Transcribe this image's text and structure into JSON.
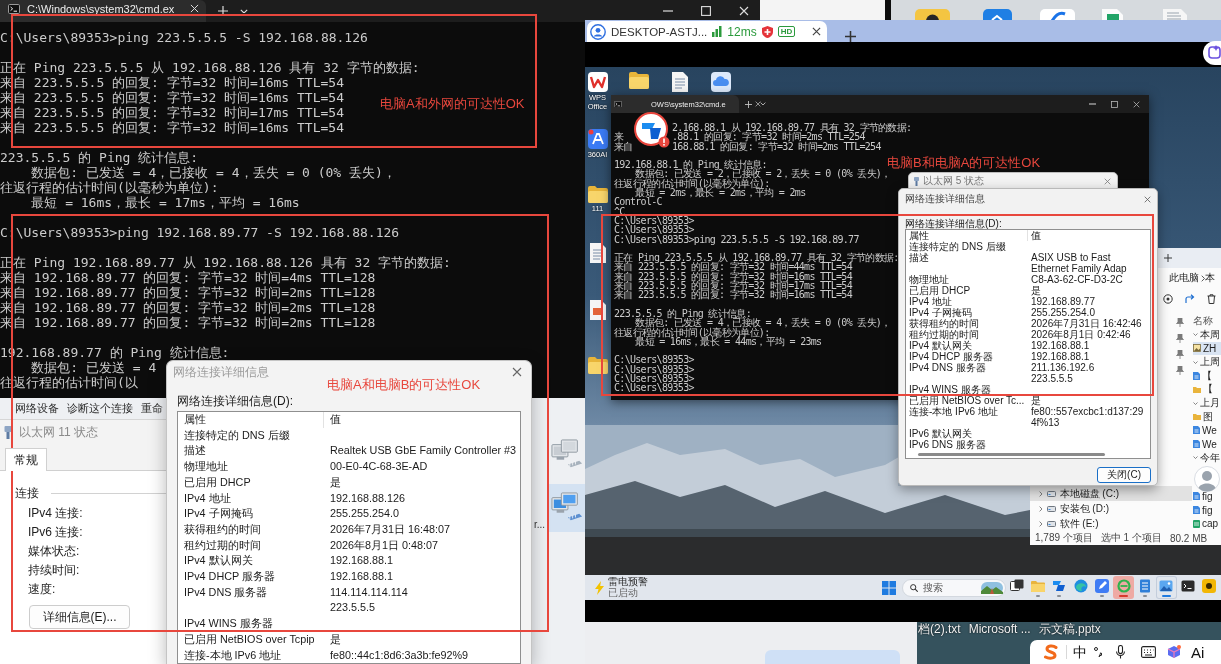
{
  "cmd_window": {
    "tab_title": "C:\\Windows\\system32\\cmd.ex",
    "output_blocks": [
      [
        "C:\\Users\\89353>ping 223.5.5.5 -S 192.168.88.126"
      ],
      [
        "正在 Ping 223.5.5.5 从 192.168.88.126 具有 32 字节的数据:",
        "来自 223.5.5.5 的回复: 字节=32 时间=16ms TTL=54",
        "来自 223.5.5.5 的回复: 字节=32 时间=16ms TTL=54",
        "来自 223.5.5.5 的回复: 字节=32 时间=17ms TTL=54",
        "来自 223.5.5.5 的回复: 字节=32 时间=16ms TTL=54"
      ],
      [
        "223.5.5.5 的 Ping 统计信息:",
        "    数据包: 已发送 = 4，已接收 = 4，丢失 = 0 (0% 丢失)，",
        "往返行程的估计时间(以毫秒为单位):",
        "    最短 = 16ms，最长 = 17ms，平均 = 16ms"
      ],
      [
        "C:\\Users\\89353>ping 192.168.89.77 -S 192.168.88.126"
      ],
      [
        "正在 Ping 192.168.89.77 从 192.168.88.126 具有 32 字节的数据:",
        "来自 192.168.89.77 的回复: 字节=32 时间=4ms TTL=128",
        "来自 192.168.89.77 的回复: 字节=32 时间=2ms TTL=128",
        "来自 192.168.89.77 的回复: 字节=32 时间=2ms TTL=128",
        "来自 192.168.89.77 的回复: 字节=32 时间=2ms TTL=128"
      ],
      [
        "192.168.89.77 的 Ping 统计信息:",
        "    数据包: 已发送 = 4",
        "往返行程的估计时间(以"
      ]
    ]
  },
  "connections_window": {
    "toolbar": [
      "网络设备",
      "诊断这个连接",
      "重命"
    ],
    "label_fragment": "r...",
    "adapters": [
      {
        "connected": false,
        "selected": false
      },
      {
        "connected": true,
        "selected": true
      }
    ]
  },
  "status_dialog": {
    "title": "以太网 11 状态",
    "tabs": [
      {
        "label": "常规",
        "selected": true
      }
    ],
    "section": "连接",
    "fields": [
      "IPv4 连接:",
      "IPv6 连接:",
      "媒体状态:",
      "持续时间:",
      "速度:"
    ],
    "details_button": "详细信息(E)..."
  },
  "details_dialog": {
    "title": "网络连接详细信息",
    "list_label": "网络连接详细信息(D):",
    "columns": [
      "属性",
      "值"
    ],
    "rows": [
      {
        "property": "连接特定的 DNS 后缀"
      },
      {
        "property": "描述",
        "value": "Realtek USB GbE Family Controller #3"
      },
      {
        "property": "物理地址",
        "value": "00-E0-4C-68-3E-AD"
      },
      {
        "property": "已启用 DHCP",
        "value": "是"
      },
      {
        "property": "IPv4 地址",
        "value": "192.168.88.126"
      },
      {
        "property": "IPv4 子网掩码",
        "value": "255.255.254.0"
      },
      {
        "property": "获得租约的时间",
        "value": "2026年7月31日 16:48:07"
      },
      {
        "property": "租约过期的时间",
        "value": "2026年8月1日 0:48:07"
      },
      {
        "property": "IPv4 默认网关",
        "value": "192.168.88.1"
      },
      {
        "property": "IPv4 DHCP 服务器",
        "value": "192.168.88.1"
      },
      {
        "property": "IPv4 DNS 服务器",
        "value": "114.114.114.114"
      },
      {
        "value": "223.5.5.5"
      },
      {
        "property": "IPv4 WINS 服务器"
      },
      {
        "property": "已启用 NetBIOS over Tcpip",
        "value": "是"
      },
      {
        "property": "连接-本地 IPv6 地址",
        "value": "fe80::44c1:8d6:3a3b:fe92%9"
      }
    ]
  },
  "remote_window": {
    "tab": {
      "title": "DESKTOP-ASTJ...",
      "latency": "12ms",
      "quality_badge": "HD"
    },
    "desktop_icon_columns": [
      [
        {
          "kind": "wps",
          "label": "WPS Office"
        },
        {
          "kind": "ai",
          "label": "360AI"
        },
        {
          "kind": "folder",
          "label": "111"
        },
        {
          "kind": "text-file"
        },
        {
          "kind": "presentation"
        },
        {
          "kind": "folder"
        }
      ],
      [
        {
          "kind": "folder"
        }
      ],
      [
        {
          "kind": "text-file"
        }
      ],
      [
        {
          "kind": "cloud"
        }
      ]
    ],
    "cmd_window": {
      "tab_title": "OWS\\system32\\cmd.e",
      "covered_lines": [
        {
          "right": "2.168.88.1 从 192.168.89.77 具有 32 字节的数据:"
        },
        {
          "left": "来",
          "right": ".88.1 的回复: 字节=32 时间=2ms TTL=254"
        },
        {
          "left": "来自",
          "right": "168.88.1 的回复: 字节=32 时间=2ms TTL=254"
        }
      ],
      "output_blocks": [
        [
          "192.168.88.1 的 Ping 统计信息:",
          "    数据包: 已发送 = 2，已接收 = 2，丢失 = 0 (0% 丢失)，",
          "往返行程的估计时间(以毫秒为单位):",
          "    最短 = 2ms，最长 = 2ms，平均 = 2ms",
          "Control-C",
          "^C",
          "C:\\Users\\89353>",
          "C:\\Users\\89353>",
          "C:\\Users\\89353>ping 223.5.5.5 -S 192.168.89.77"
        ],
        [
          "正在 Ping 223.5.5.5 从 192.168.89.77 具有 32 字节的数据:",
          "来自 223.5.5.5 的回复: 字节=32 时间=44ms TTL=54",
          "来自 223.5.5.5 的回复: 字节=32 时间=16ms TTL=54",
          "来自 223.5.5.5 的回复: 字节=32 时间=17ms TTL=54",
          "来自 223.5.5.5 的回复: 字节=32 时间=16ms TTL=54"
        ],
        [
          "223.5.5.5 的 Ping 统计信息:",
          "    数据包: 已发送 = 4，已接收 = 4，丢失 = 0 (0% 丢失)，",
          "往返行程的估计时间(以毫秒为单位):",
          "    最短 = 16ms，最长 = 44ms，平均 = 23ms"
        ],
        [
          "C:\\Users\\89353>",
          "C:\\Users\\89353>",
          "C:\\Users\\89353>",
          "C:\\Users\\89353>"
        ]
      ]
    },
    "status_window_title": "以太网 5 状态",
    "details_dialog": {
      "title": "网络连接详细信息",
      "list_label": "网络连接详细信息(D):",
      "columns": [
        "属性",
        "值"
      ],
      "rows": [
        {
          "property": "连接特定的 DNS 后缀"
        },
        {
          "property": "描述",
          "value": "ASIX USB to Fast Ethernet Family Adap"
        },
        {
          "property": "物理地址",
          "value": "C8-A3-62-CF-D3-2C"
        },
        {
          "property": "已启用 DHCP",
          "value": "是"
        },
        {
          "property": "IPv4 地址",
          "value": "192.168.89.77"
        },
        {
          "property": "IPv4 子网掩码",
          "value": "255.255.254.0"
        },
        {
          "property": "获得租约的时间",
          "value": "2026年7月31日 16:42:46"
        },
        {
          "property": "租约过期的时间",
          "value": "2026年8月1日 0:42:46"
        },
        {
          "property": "IPv4 默认网关",
          "value": "192.168.88.1"
        },
        {
          "property": "IPv4 DHCP 服务器",
          "value": "192.168.88.1"
        },
        {
          "property": "IPv4 DNS 服务器",
          "value": "211.136.192.6"
        },
        {
          "value": "223.5.5.5"
        },
        {
          "property": "IPv4 WINS 服务器"
        },
        {
          "property": "已启用 NetBIOS over Tc...",
          "value": "是"
        },
        {
          "property": "连接-本地 IPv6 地址",
          "value": "fe80::557excbc1:d137:294f%13"
        },
        {
          "property": "IPv6 默认网关"
        },
        {
          "property": "IPv6 DNS 服务器"
        }
      ],
      "close_button": "关闭(C)"
    },
    "explorer": {
      "breadcrumb": [
        "此电脑",
        "本"
      ],
      "column_header": "名称",
      "files": [
        {
          "kind": "group",
          "label": "本周",
          "selected": false
        },
        {
          "kind": "image",
          "label": "ZH",
          "selected": true
        },
        {
          "kind": "group",
          "label": "上周",
          "selected": false
        },
        {
          "kind": "file",
          "label": "【",
          "selected": false
        },
        {
          "kind": "folder",
          "label": "【",
          "selected": false
        },
        {
          "kind": "group",
          "label": "上月",
          "selected": false
        },
        {
          "kind": "folder",
          "label": "图",
          "selected": false
        },
        {
          "kind": "file",
          "label": "We",
          "selected": false
        },
        {
          "kind": "file",
          "label": "We",
          "selected": false
        },
        {
          "kind": "group",
          "label": "今年",
          "selected": false
        }
      ],
      "files_below": [
        {
          "kind": "file",
          "label": "fig",
          "selected": false
        },
        {
          "kind": "file",
          "label": "fig",
          "selected": false
        },
        {
          "kind": "sheet",
          "label": "cap",
          "selected": false
        }
      ],
      "drives": [
        {
          "label": "本地磁盘 (C:)",
          "selected": true
        },
        {
          "label": "安装包 (D:)",
          "selected": false
        },
        {
          "label": "软件 (E:)",
          "selected": false
        }
      ],
      "item_count": "1,789 个项目",
      "selection_count": "选中 1 个项目",
      "selection_size": "80.2 MB"
    },
    "taskbar": {
      "notification_title": "雷电预警",
      "notification_status": "已启动",
      "search_placeholder": "搜索",
      "apps": [
        {
          "kind": "task-view",
          "running": false,
          "focused": false,
          "attention": false
        },
        {
          "kind": "folder",
          "running": true,
          "focused": false,
          "attention": false
        },
        {
          "kind": "remote",
          "running": true,
          "focused": false,
          "attention": false
        },
        {
          "kind": "browser",
          "running": false,
          "focused": false,
          "attention": false
        },
        {
          "kind": "pen",
          "running": true,
          "focused": false,
          "attention": false
        },
        {
          "kind": "security",
          "running": true,
          "focused": false,
          "attention": true
        },
        {
          "kind": "notepad",
          "running": true,
          "focused": false,
          "attention": false
        },
        {
          "kind": "photos",
          "running": true,
          "focused": true,
          "attention": false
        },
        {
          "kind": "terminal",
          "running": false,
          "focused": false,
          "attention": false
        },
        {
          "kind": "partial",
          "running": false,
          "focused": false,
          "attention": false
        }
      ]
    }
  },
  "desktop_files": [
    "档(2).txt",
    "Microsoft ...",
    "示文稿.pptx"
  ],
  "ime_bar": {
    "mode": "中",
    "ai_label": "Ai"
  },
  "annotations": [
    {
      "text": "电脑A和外网的可达性OK"
    },
    {
      "text": "电脑A和电脑B的可达性OK"
    },
    {
      "text": "电脑B和电脑A的可达性OK"
    }
  ]
}
